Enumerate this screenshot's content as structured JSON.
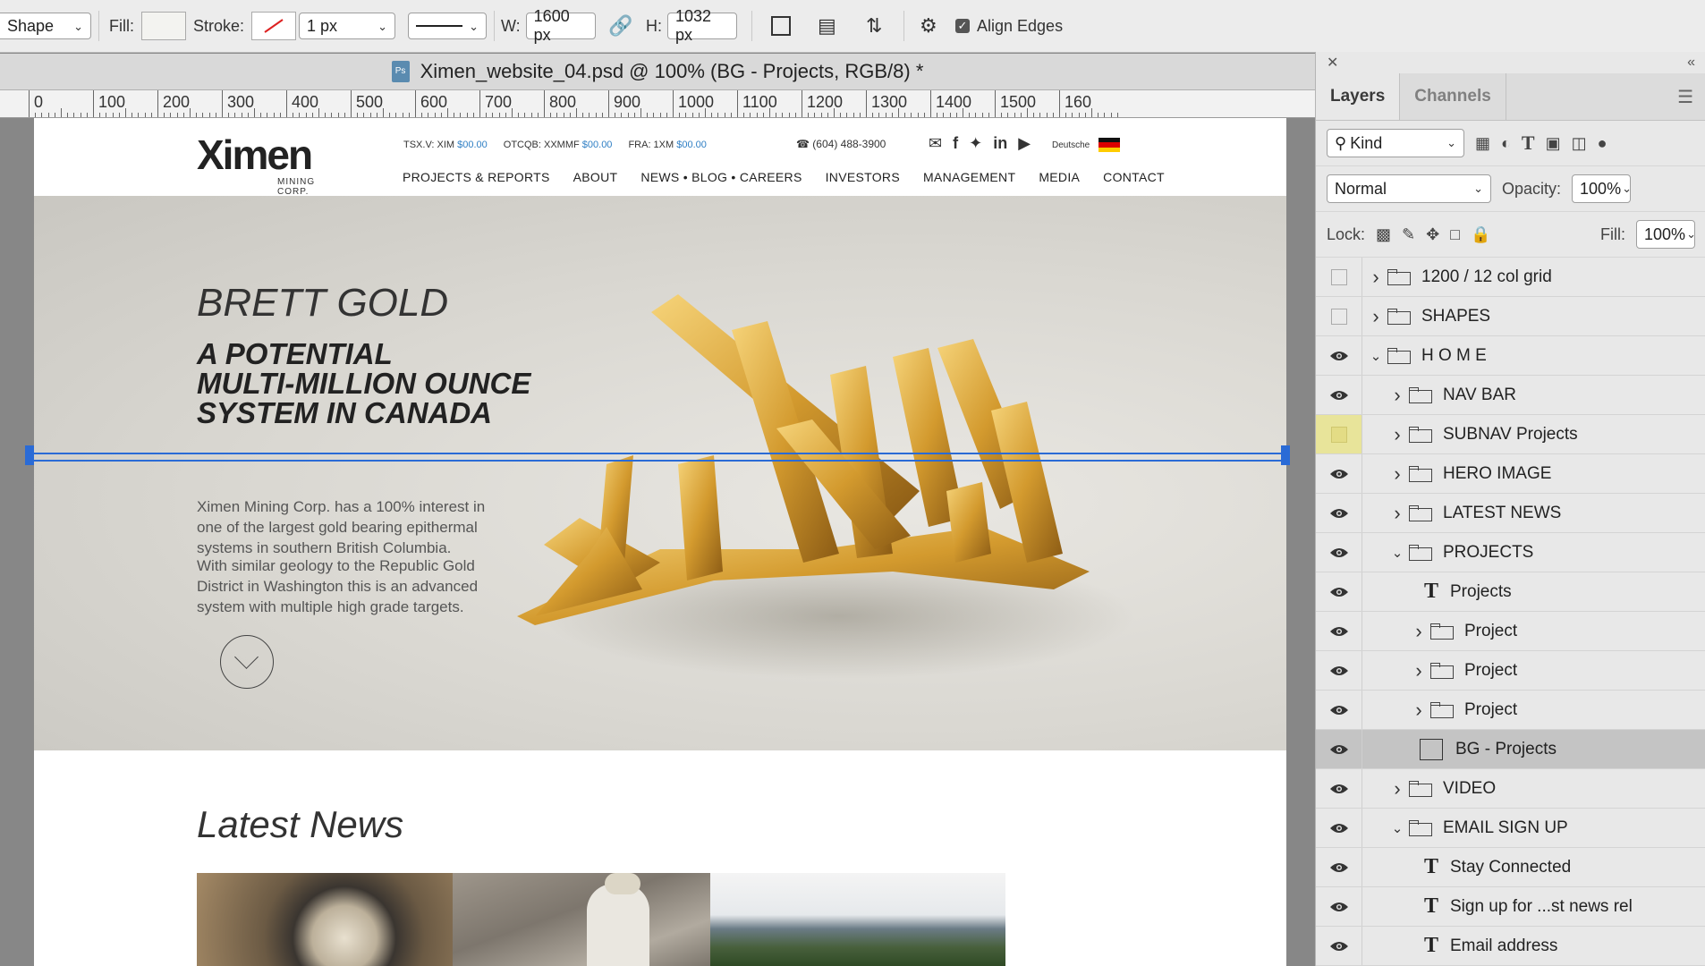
{
  "options_bar": {
    "tool_mode": "Shape",
    "fill_label": "Fill:",
    "stroke_label": "Stroke:",
    "stroke_width": "1 px",
    "w_label": "W:",
    "w_value": "1600 px",
    "h_label": "H:",
    "h_value": "1032 px",
    "align_edges_label": "Align Edges",
    "align_edges_checked": true
  },
  "document": {
    "tab_title": "Ximen_website_04.psd @ 100% (BG - Projects, RGB/8) *",
    "ps_icon": "Ps"
  },
  "ruler": {
    "labels": [
      "0",
      "100",
      "200",
      "300",
      "400",
      "500",
      "600",
      "700",
      "800",
      "900",
      "1000",
      "1100",
      "1200",
      "1300",
      "1400",
      "1500",
      "160"
    ]
  },
  "site": {
    "logo_text": "Ximen",
    "logo_sub": "MINING CORP.",
    "tickers": [
      {
        "label": "TSX.V: XIM",
        "value": "$00.00"
      },
      {
        "label": "OTCQB: XXMMF",
        "value": "$00.00"
      },
      {
        "label": "FRA: 1XM",
        "value": "$00.00"
      }
    ],
    "phone": "(604) 488-3900",
    "language": "Deutsche",
    "nav": [
      "PROJECTS & REPORTS",
      "ABOUT",
      "NEWS • BLOG • CAREERS",
      "INVESTORS",
      "MANAGEMENT",
      "MEDIA",
      "CONTACT"
    ],
    "hero": {
      "kicker": "BRETT GOLD",
      "headline_1": "A POTENTIAL",
      "headline_2": "MULTI-MILLION OUNCE",
      "headline_3": "SYSTEM IN CANADA",
      "para_1": "Ximen Mining Corp. has a 100% interest in one of the largest gold bearing epithermal systems in southern British Columbia.",
      "para_2": "With similar geology to the Republic Gold District in Washington this is an advanced system with multiple high grade targets."
    },
    "latest_news_title": "Latest News"
  },
  "panel": {
    "tabs": [
      "Layers",
      "Channels"
    ],
    "filter_kind": "Kind",
    "blend_mode": "Normal",
    "opacity_label": "Opacity:",
    "opacity_value": "100%",
    "lock_label": "Lock:",
    "fill_label": "Fill:",
    "fill_value": "100%",
    "layers": [
      {
        "name": "1200 / 12 col grid",
        "type": "folder",
        "indent": 0,
        "visible": false,
        "expanded": false
      },
      {
        "name": "SHAPES",
        "type": "folder",
        "indent": 0,
        "visible": false,
        "expanded": false
      },
      {
        "name": "H O M E",
        "type": "folder",
        "indent": 0,
        "visible": true,
        "expanded": true
      },
      {
        "name": "NAV BAR",
        "type": "folder",
        "indent": 1,
        "visible": true,
        "expanded": false
      },
      {
        "name": "SUBNAV Projects",
        "type": "folder",
        "indent": 1,
        "visible": false,
        "expanded": false,
        "highlight": "#e8e49a"
      },
      {
        "name": "HERO IMAGE",
        "type": "folder",
        "indent": 1,
        "visible": true,
        "expanded": false
      },
      {
        "name": "LATEST NEWS",
        "type": "folder",
        "indent": 1,
        "visible": true,
        "expanded": false
      },
      {
        "name": "PROJECTS",
        "type": "folder",
        "indent": 1,
        "visible": true,
        "expanded": true
      },
      {
        "name": "Projects",
        "type": "text",
        "indent": 2,
        "visible": true
      },
      {
        "name": "Project",
        "type": "folder",
        "indent": 2,
        "visible": true,
        "expanded": false
      },
      {
        "name": "Project",
        "type": "folder",
        "indent": 2,
        "visible": true,
        "expanded": false
      },
      {
        "name": "Project",
        "type": "folder",
        "indent": 2,
        "visible": true,
        "expanded": false
      },
      {
        "name": "BG - Projects",
        "type": "shape",
        "indent": 2,
        "visible": true,
        "selected": true
      },
      {
        "name": "VIDEO",
        "type": "folder",
        "indent": 1,
        "visible": true,
        "expanded": false
      },
      {
        "name": "EMAIL SIGN UP",
        "type": "folder",
        "indent": 1,
        "visible": true,
        "expanded": true
      },
      {
        "name": "Stay Connected",
        "type": "text",
        "indent": 2,
        "visible": true
      },
      {
        "name": "Sign up for ...st news rel",
        "type": "text",
        "indent": 2,
        "visible": true
      },
      {
        "name": "Email address",
        "type": "text",
        "indent": 2,
        "visible": true
      }
    ]
  },
  "colors": {
    "accent_blue": "#2a6bd6",
    "ticker_blue": "#2f7fc4",
    "selected_layer": "#c4c4c4",
    "gold": "#d9a43a"
  }
}
